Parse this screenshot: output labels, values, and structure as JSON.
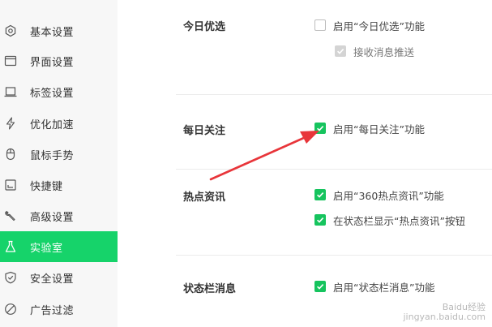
{
  "sidebar": {
    "items": [
      {
        "label": "基本设置",
        "icon": "gear-icon"
      },
      {
        "label": "界面设置",
        "icon": "window-icon"
      },
      {
        "label": "标签设置",
        "icon": "tab-icon"
      },
      {
        "label": "优化加速",
        "icon": "lightning-icon"
      },
      {
        "label": "鼠标手势",
        "icon": "mouse-icon"
      },
      {
        "label": "快捷键",
        "icon": "keyboard-icon"
      },
      {
        "label": "高级设置",
        "icon": "wrench-icon"
      },
      {
        "label": "实验室",
        "icon": "flask-icon",
        "active": true
      },
      {
        "label": "安全设置",
        "icon": "shield-icon"
      },
      {
        "label": "广告过滤",
        "icon": "block-icon"
      }
    ],
    "active_color": "#16d36a"
  },
  "sections": [
    {
      "title": "今日优选",
      "options": [
        {
          "label": "启用“今日优选”功能",
          "state": "unchecked"
        },
        {
          "label": "接收消息推送",
          "state": "checked-disabled"
        }
      ]
    },
    {
      "title": "每日关注",
      "options": [
        {
          "label": "启用“每日关注”功能",
          "state": "checked"
        }
      ]
    },
    {
      "title": "热点资讯",
      "options": [
        {
          "label": "启用“360热点资讯”功能",
          "state": "checked"
        },
        {
          "label": "在状态栏显示“热点资讯”按钮",
          "state": "checked"
        }
      ]
    },
    {
      "title": "状态栏消息",
      "options": [
        {
          "label": "启用“状态栏消息”功能",
          "state": "checked"
        }
      ]
    }
  ],
  "watermark": {
    "line1": "Baidu经验",
    "line2": "jingyan.baidu.com"
  },
  "colors": {
    "checkbox_on": "#16c45e",
    "annotation_arrow": "#e8353a"
  }
}
